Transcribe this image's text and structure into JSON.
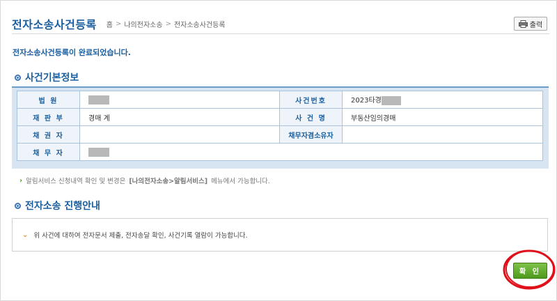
{
  "header": {
    "title": "전자소송사건등록",
    "breadcrumb": [
      "홈",
      "나의전자소송",
      "전자소송사건등록"
    ],
    "print_label": "출력"
  },
  "message": "전자소송사건등록이 완료되었습니다.",
  "sections": {
    "basic_info_title": "사건기본정보",
    "progress_title": "전자소송 진행안내"
  },
  "case_info": {
    "court_label": "법 원",
    "court_value": "",
    "case_number_label": "사건번호",
    "case_number_value": "2023타경",
    "division_label": "재 판 부",
    "division_value": "경매 계",
    "case_name_label": "사 건 명",
    "case_name_value": "부동산임의경매",
    "creditor_label": "채 권 자",
    "creditor_value": "",
    "owner_label": "채무자겸소유자",
    "owner_value": "",
    "debtor_label": "채 무 자",
    "debtor_value": ""
  },
  "notice": {
    "prefix": "알림서비스 신청내역 확인 및 변경은",
    "bold": "[나의전자소송>알림서비스]",
    "suffix": "메뉴에서 가능합니다."
  },
  "guide_text": "위 사건에 대하여 전자문서 제출, 전자송달 확인, 사건기록 열람이 가능합니다.",
  "confirm_label": "확 인",
  "colors": {
    "title_blue": "#1a5fa0",
    "confirm_green": "#5fa82a",
    "annotation_red": "#e0101a"
  },
  "icons": [
    "printer-icon",
    "section-bullet-icon",
    "green-arrow-icon",
    "orange-chevron-icon"
  ]
}
